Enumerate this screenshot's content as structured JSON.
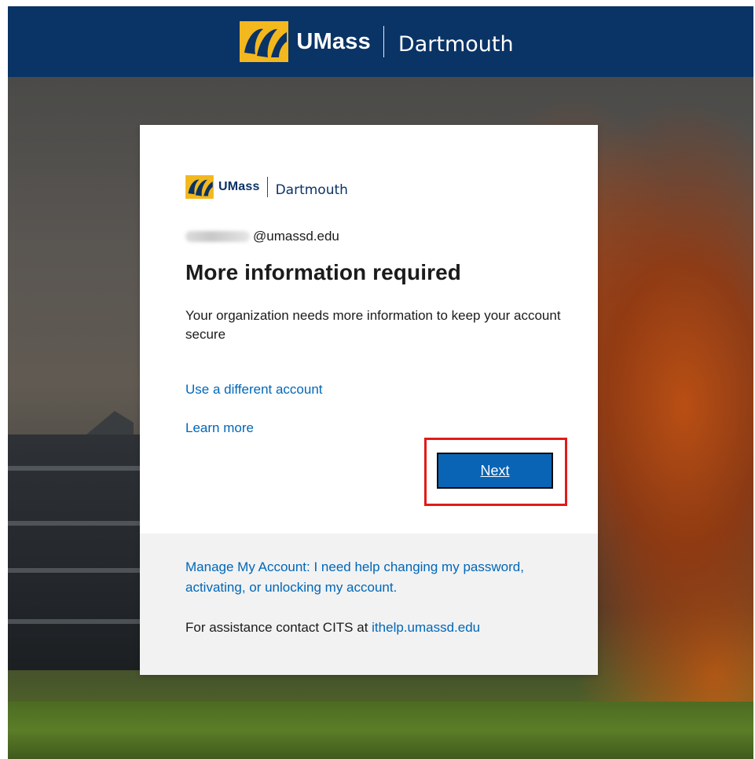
{
  "header": {
    "brand_word": "UMass",
    "brand_sub": "Dartmouth",
    "logo_icon": "umass-logo-icon",
    "bar_color": "#0a3366"
  },
  "card": {
    "logo": {
      "brand_word": "UMass",
      "brand_sub": "Dartmouth"
    },
    "email_suffix": "@umassd.edu",
    "title": "More information required",
    "description": "Your organization needs more information to keep your account secure",
    "use_different_account": "Use a different account",
    "learn_more": "Learn more",
    "next_label": "Next",
    "highlight_color": "#e11a1a",
    "button_color": "#0a64b5",
    "link_color": "#0067b8"
  },
  "footer": {
    "manage_account": "Manage My Account: I need help changing my password, activating, or unlocking my account.",
    "assist_text": "For assistance contact CITS at ",
    "assist_link": "ithelp.umassd.edu"
  }
}
